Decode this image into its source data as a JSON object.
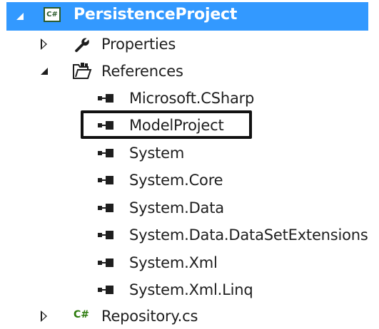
{
  "solution_explorer": {
    "project": {
      "label": "PersistenceProject",
      "icon": "csharp-project-icon",
      "expanded": true,
      "selected": true
    },
    "items": [
      {
        "label": "Properties",
        "icon": "wrench-icon",
        "expanded": false
      },
      {
        "label": "References",
        "icon": "references-folder-icon",
        "expanded": true,
        "children": [
          {
            "label": "Microsoft.CSharp",
            "icon": "reference-icon"
          },
          {
            "label": "ModelProject",
            "icon": "reference-icon",
            "highlighted": true
          },
          {
            "label": "System",
            "icon": "reference-icon"
          },
          {
            "label": "System.Core",
            "icon": "reference-icon"
          },
          {
            "label": "System.Data",
            "icon": "reference-icon"
          },
          {
            "label": "System.Data.DataSetExtensions",
            "icon": "reference-icon"
          },
          {
            "label": "System.Xml",
            "icon": "reference-icon"
          },
          {
            "label": "System.Xml.Linq",
            "icon": "reference-icon"
          }
        ]
      },
      {
        "label": "Repository.cs",
        "icon": "csharp-file-icon",
        "expanded": false
      }
    ]
  },
  "icon_text": {
    "csproj": "C#",
    "csfile": "C#"
  },
  "colors": {
    "selection": "#3399ff",
    "text": "#1e1e1e",
    "csharp_green": "#2b7a0b",
    "highlight_border": "#111111"
  }
}
